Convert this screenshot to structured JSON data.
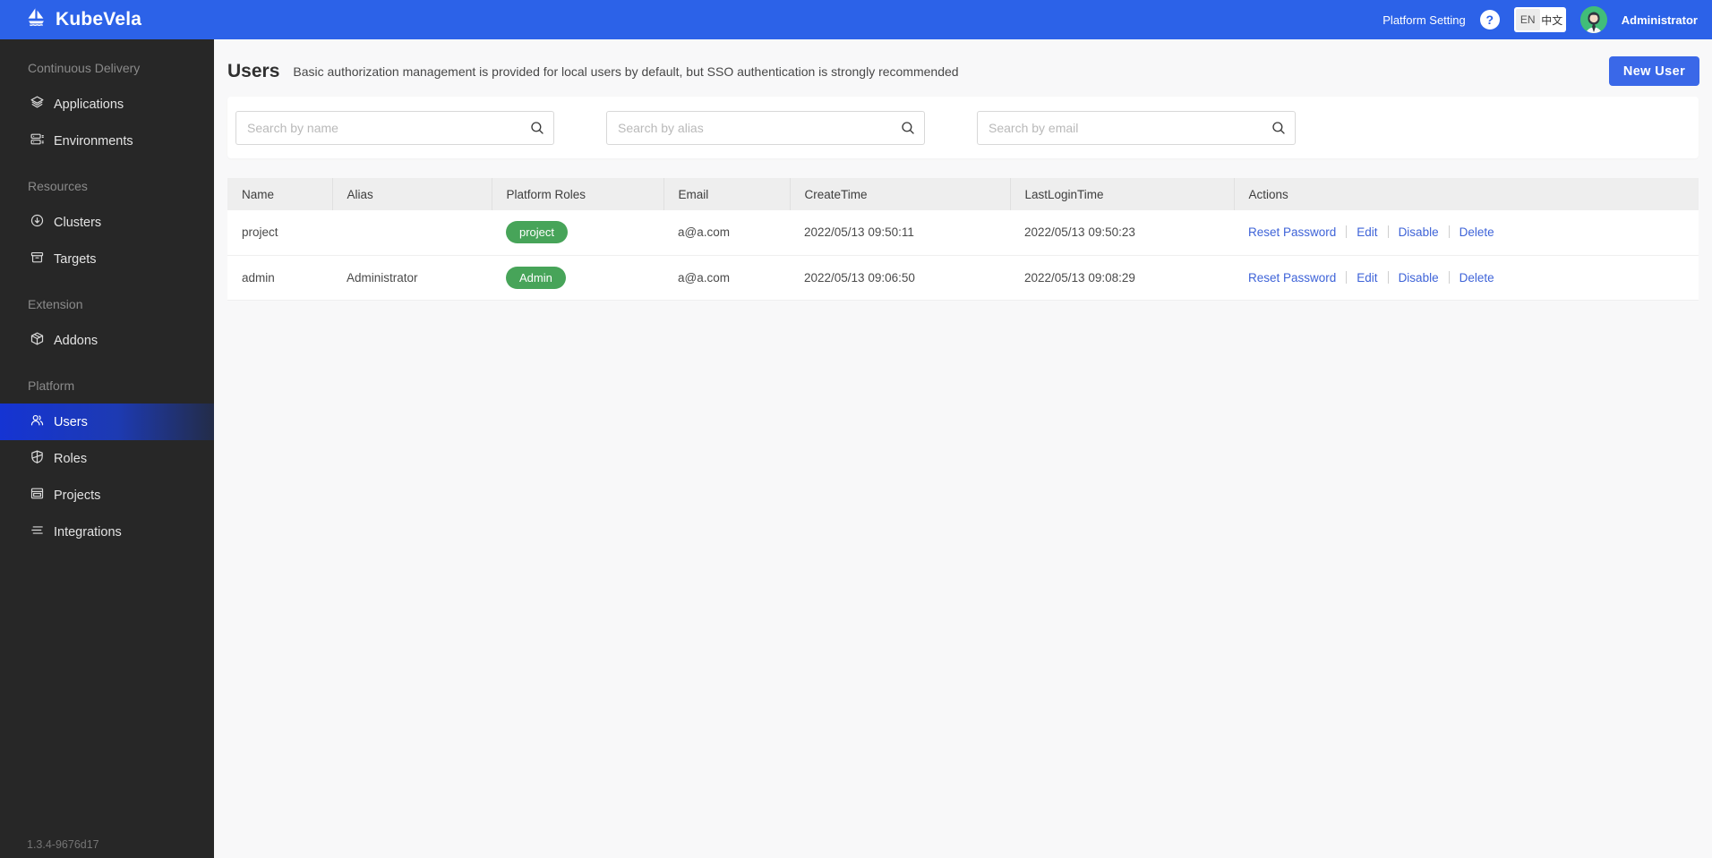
{
  "header": {
    "brand": "KubeVela",
    "platform_setting": "Platform Setting",
    "help_label": "?",
    "lang_en": "EN",
    "lang_zh": "中文",
    "user": "Administrator"
  },
  "sidebar": {
    "sections": [
      {
        "label": "Continuous Delivery",
        "items": [
          {
            "label": "Applications"
          },
          {
            "label": "Environments"
          }
        ]
      },
      {
        "label": "Resources",
        "items": [
          {
            "label": "Clusters"
          },
          {
            "label": "Targets"
          }
        ]
      },
      {
        "label": "Extension",
        "items": [
          {
            "label": "Addons"
          }
        ]
      },
      {
        "label": "Platform",
        "items": [
          {
            "label": "Users"
          },
          {
            "label": "Roles"
          },
          {
            "label": "Projects"
          },
          {
            "label": "Integrations"
          }
        ]
      }
    ],
    "version": "1.3.4-9676d17"
  },
  "page": {
    "title": "Users",
    "subtitle": "Basic authorization management is provided for local users by default, but SSO authentication is strongly recommended",
    "new_user_button": "New User"
  },
  "search": {
    "by_name_placeholder": "Search by name",
    "by_alias_placeholder": "Search by alias",
    "by_email_placeholder": "Search by email"
  },
  "table": {
    "columns": [
      "Name",
      "Alias",
      "Platform Roles",
      "Email",
      "CreateTime",
      "LastLoginTime",
      "Actions"
    ],
    "rows": [
      {
        "name": "project",
        "alias": "",
        "role": "project",
        "email": "a@a.com",
        "create_time": "2022/05/13 09:50:11",
        "last_login_time": "2022/05/13 09:50:23"
      },
      {
        "name": "admin",
        "alias": "Administrator",
        "role": "Admin",
        "email": "a@a.com",
        "create_time": "2022/05/13 09:06:50",
        "last_login_time": "2022/05/13 09:08:29"
      }
    ],
    "actions": [
      "Reset Password",
      "Edit",
      "Disable",
      "Delete"
    ]
  },
  "colors": {
    "topbar_blue": "#2c62e8",
    "button_blue": "#3a68e8",
    "sidebar_dark": "#272727",
    "active_gradient_start": "#1534d3",
    "role_green": "#47a459",
    "link_blue": "#3e63d8",
    "avatar_green": "#41bd79"
  }
}
